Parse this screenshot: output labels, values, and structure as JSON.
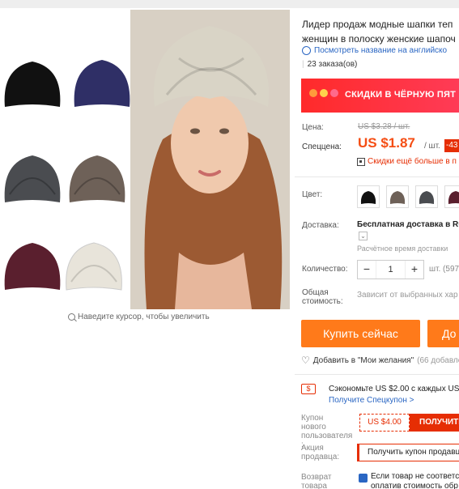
{
  "gallery": {
    "zoom_hint": "Наведите курсор, чтобы увеличить",
    "thumb_colors": [
      "#111111",
      "#2f2f66",
      "#4a4c50",
      "#6e6158",
      "#5a1f2e",
      "#e8e4da"
    ],
    "main_hat_color": "#d9d4c6"
  },
  "product": {
    "title_line1": "Лидер продаж модные шапки теп",
    "title_line2": "женщин в полоску женские шапоч",
    "translate_link": "Посмотреть название на английско",
    "orders": "23 заказа(ов)"
  },
  "banner": {
    "text": "СКИДКИ В ЧЁРНУЮ ПЯТ",
    "dot_colors": [
      "#ff9a3c",
      "#ffd24c",
      "#ff6a8b"
    ]
  },
  "price": {
    "label": "Цена:",
    "old": "US $3.28 / шт.",
    "sale_label": "Спеццена:",
    "new": "US $1.87",
    "unit": "/ шт.",
    "discount": "-43",
    "app_discount": "Скидки ещё больше в п"
  },
  "color": {
    "label": "Цвет:",
    "swatches": [
      "#111111",
      "#6e6158",
      "#4a4c50",
      "#5a1f2e"
    ]
  },
  "shipping": {
    "label": "Доставка:",
    "title": "Бесплатная доставка в Ru",
    "estimate": "Расчётное время доставки"
  },
  "quantity": {
    "label": "Количество:",
    "minus": "−",
    "value": "1",
    "plus": "+",
    "unit": "шт. (597"
  },
  "total": {
    "label_line1": "Общая",
    "label_line2": "стоимость:",
    "note": "Зависит от выбранных хар"
  },
  "actions": {
    "buy_now": "Купить сейчас",
    "add_to_cart": "До",
    "wishlist": "Добавить в \"Мои желания\"",
    "wishlist_count": "(66 добавле"
  },
  "coupon": {
    "save_icon": "$",
    "save_text": "Сэкономьте US $2.00 с каждых US $",
    "save_link": "Получите Спецкупон >",
    "new_user_label_1": "Купон нового",
    "new_user_label_2": "пользователя",
    "new_user_label_3": ":",
    "new_user_amount": "US $4.00",
    "new_user_button": "ПОЛУЧИТЕ",
    "promo_label_1": "Акция",
    "promo_label_2": "продавца:",
    "promo_button": "Получить купон продавц",
    "return_label_1": "Возврат",
    "return_label_2": "товара",
    "return_text_1": "Если товар не соответст",
    "return_text_2": "оплатив стоимость обр"
  }
}
